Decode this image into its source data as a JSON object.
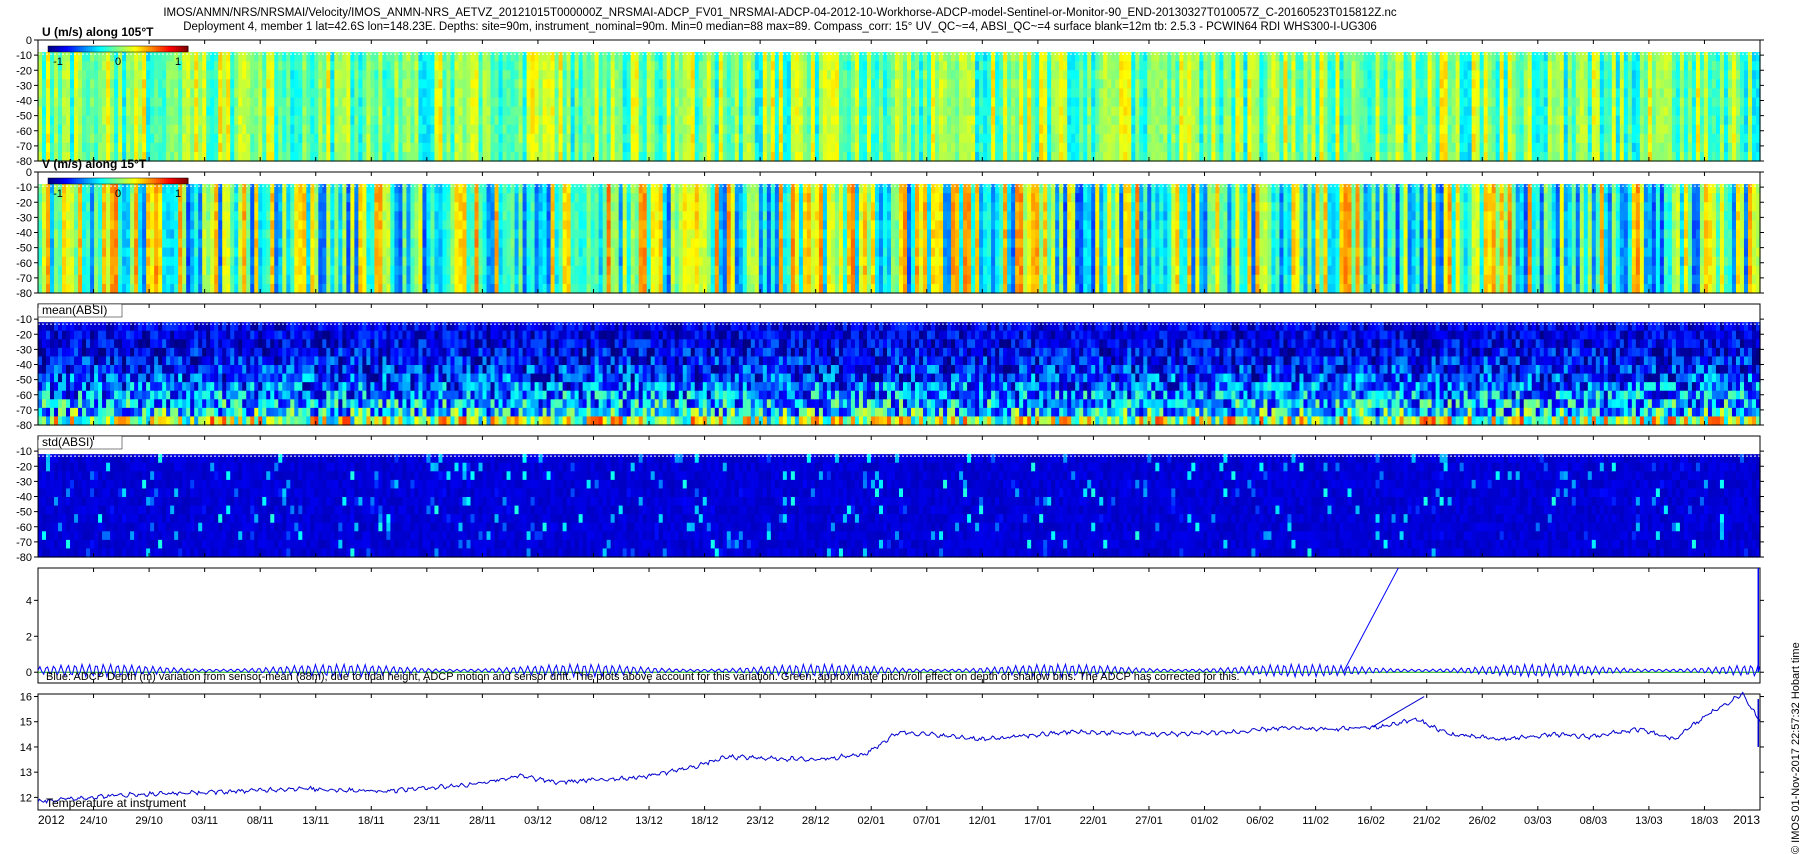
{
  "header": {
    "title_line1": "IMOS/ANMN/NRS/NRSMAI/Velocity/IMOS_ANMN-NRS_AETVZ_20121015T000000Z_NRSMAI-ADCP_FV01_NRSMAI-ADCP-04-2012-10-Workhorse-ADCP-model-Sentinel-or-Monitor-90_END-20130327T010057Z_C-20160523T015812Z.nc",
    "title_line2": "Deployment 4, member 1 lat=42.6S lon=148.23E. Depths: site=90m, instrument_nominal=90m. Min=0 median=88 max=89. Compass_corr: 15° UV_QC~=4, ABSI_QC~=4 surface blank=12m tb: 2.5.3 - PCWIN64 RDI WHS300-I-UG306",
    "side_label": "© IMOS 01-Nov-2017 22:57:32 Hobart time"
  },
  "colors": {
    "jet_low": "#00007f",
    "jet_mid": "#7fff7f",
    "jet_high": "#7f0000",
    "depth_line": "#0000ff",
    "temp_line": "#0000cc",
    "pitch_line": "#00aa00"
  },
  "chart_data": [
    {
      "type": "heatmap",
      "name": "U",
      "label": "U (m/s) along 105°T",
      "yticks": [
        0,
        -10,
        -20,
        -30,
        -40,
        -50,
        -60,
        -70,
        -80
      ],
      "ylim": [
        -80,
        0
      ],
      "colorbar": {
        "min": -1,
        "max": 1,
        "ticks": [
          "-1",
          "0",
          "1"
        ]
      },
      "surface_blank_depth": -8,
      "typical_level": 0.5,
      "variation": 0.3
    },
    {
      "type": "heatmap",
      "name": "V",
      "label": "V (m/s) along 15°T",
      "yticks": [
        0,
        -10,
        -20,
        -30,
        -40,
        -50,
        -60,
        -70,
        -80
      ],
      "ylim": [
        -80,
        0
      ],
      "colorbar": {
        "min": -1,
        "max": 1,
        "ticks": [
          "-1",
          "0",
          "1"
        ]
      },
      "surface_blank_depth": -8,
      "typical_level": 0.47,
      "variation": 0.55
    },
    {
      "type": "heatmap",
      "name": "meanABSI",
      "label": "mean(ABSI)",
      "yticks": [
        -10,
        -20,
        -30,
        -40,
        -50,
        -60,
        -70,
        -80
      ],
      "ylim": [
        -80,
        0
      ],
      "surface_blank_depth": -12,
      "typical_level": 0.25,
      "variation": 0.4
    },
    {
      "type": "heatmap",
      "name": "stdABSI",
      "label": "std(ABSI)",
      "yticks": [
        -10,
        -20,
        -30,
        -40,
        -50,
        -60,
        -70,
        -80
      ],
      "ylim": [
        -80,
        0
      ],
      "surface_blank_depth": -12,
      "typical_level": 0.08,
      "variation": 0.1
    },
    {
      "type": "line",
      "name": "depth_variation",
      "yticks": [
        0,
        2,
        4
      ],
      "ylim": [
        -0.6,
        5.8
      ],
      "annotation": "Blue: ADCP Depth (m) variation from sensor-mean (88m), due to tidal height, ADCP motion and sensor drift. The plots above account for this variation. Green: approximate pitch/roll effect on depth of shallow bins. The ADCP has corrected for this.",
      "series": [
        {
          "type": "tidal",
          "amplitude": 0.35,
          "mean": 0.1
        },
        {
          "type": "segment",
          "points": [
            [
              0.758,
              0
            ],
            [
              0.79,
              5.8
            ]
          ]
        },
        {
          "type": "spike",
          "x": 0.999,
          "values": [
            0,
            5.8
          ]
        }
      ]
    },
    {
      "type": "line",
      "name": "temperature",
      "yticks": [
        12,
        13,
        14,
        15,
        16
      ],
      "ylim": [
        11.5,
        16.1
      ],
      "annotation": "Temperature at instrument",
      "series": [
        {
          "name": "temperature",
          "x": [
            0,
            0.05,
            0.1,
            0.15,
            0.2,
            0.25,
            0.28,
            0.3,
            0.35,
            0.38,
            0.4,
            0.45,
            0.48,
            0.5,
            0.55,
            0.6,
            0.65,
            0.7,
            0.72,
            0.75,
            0.78,
            0.8,
            0.82,
            0.85,
            0.88,
            0.9,
            0.93,
            0.95,
            0.97,
            0.99,
            1.0
          ],
          "y": [
            11.85,
            12.1,
            12.2,
            12.35,
            12.25,
            12.5,
            12.85,
            12.6,
            12.8,
            13.2,
            13.6,
            13.5,
            13.7,
            14.6,
            14.3,
            14.6,
            14.5,
            14.6,
            14.75,
            14.7,
            14.8,
            15.1,
            14.5,
            14.3,
            14.5,
            14.4,
            14.7,
            14.3,
            15.3,
            16.1,
            15.0
          ]
        },
        {
          "type": "segment",
          "points": [
            [
              0.775,
              14.8
            ],
            [
              0.805,
              16.0
            ]
          ]
        }
      ],
      "xticks": [
        "2012",
        "24/10",
        "29/10",
        "03/11",
        "08/11",
        "13/11",
        "18/11",
        "23/11",
        "28/11",
        "03/12",
        "08/12",
        "13/12",
        "18/12",
        "23/12",
        "28/12",
        "02/01",
        "07/01",
        "12/01",
        "17/01",
        "22/01",
        "27/01",
        "01/02",
        "06/02",
        "11/02",
        "16/02",
        "21/02",
        "26/02",
        "03/03",
        "08/03",
        "13/03",
        "18/03",
        "2013"
      ]
    }
  ]
}
